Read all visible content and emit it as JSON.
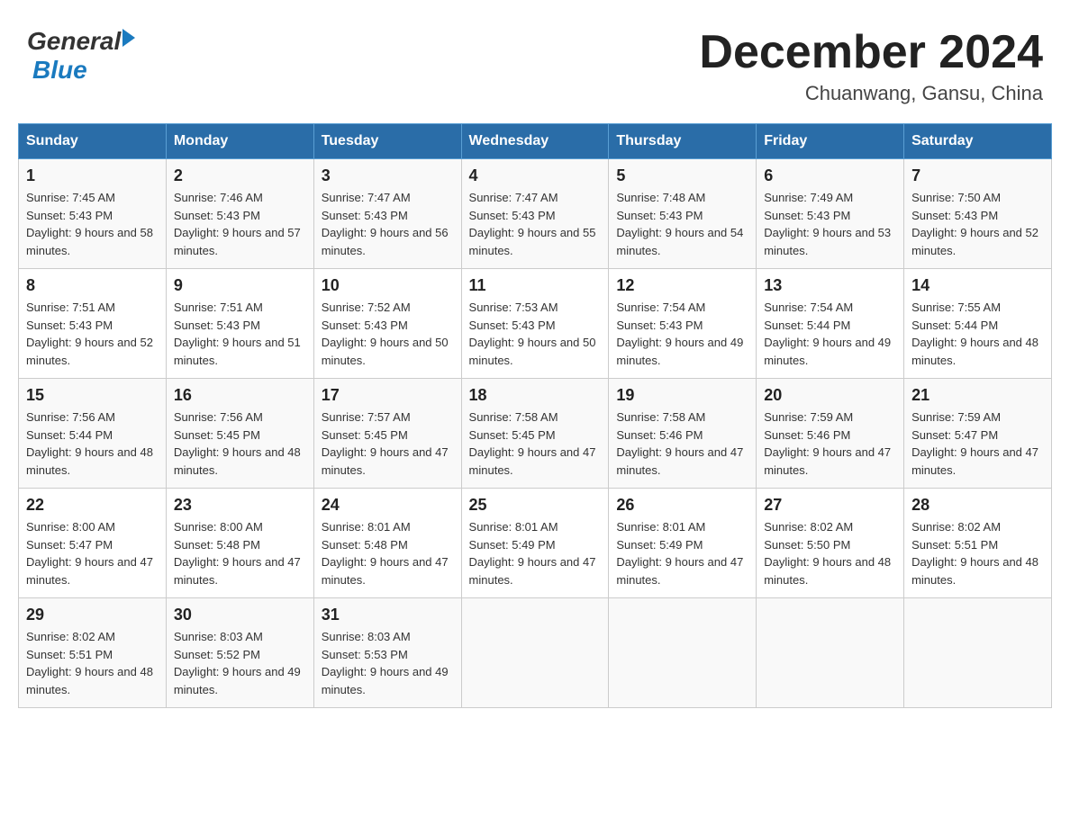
{
  "header": {
    "logo": {
      "general": "General",
      "blue": "Blue"
    },
    "title": "December 2024",
    "subtitle": "Chuanwang, Gansu, China"
  },
  "weekdays": [
    "Sunday",
    "Monday",
    "Tuesday",
    "Wednesday",
    "Thursday",
    "Friday",
    "Saturday"
  ],
  "weeks": [
    [
      {
        "day": "1",
        "sunrise": "7:45 AM",
        "sunset": "5:43 PM",
        "daylight": "9 hours and 58 minutes."
      },
      {
        "day": "2",
        "sunrise": "7:46 AM",
        "sunset": "5:43 PM",
        "daylight": "9 hours and 57 minutes."
      },
      {
        "day": "3",
        "sunrise": "7:47 AM",
        "sunset": "5:43 PM",
        "daylight": "9 hours and 56 minutes."
      },
      {
        "day": "4",
        "sunrise": "7:47 AM",
        "sunset": "5:43 PM",
        "daylight": "9 hours and 55 minutes."
      },
      {
        "day": "5",
        "sunrise": "7:48 AM",
        "sunset": "5:43 PM",
        "daylight": "9 hours and 54 minutes."
      },
      {
        "day": "6",
        "sunrise": "7:49 AM",
        "sunset": "5:43 PM",
        "daylight": "9 hours and 53 minutes."
      },
      {
        "day": "7",
        "sunrise": "7:50 AM",
        "sunset": "5:43 PM",
        "daylight": "9 hours and 52 minutes."
      }
    ],
    [
      {
        "day": "8",
        "sunrise": "7:51 AM",
        "sunset": "5:43 PM",
        "daylight": "9 hours and 52 minutes."
      },
      {
        "day": "9",
        "sunrise": "7:51 AM",
        "sunset": "5:43 PM",
        "daylight": "9 hours and 51 minutes."
      },
      {
        "day": "10",
        "sunrise": "7:52 AM",
        "sunset": "5:43 PM",
        "daylight": "9 hours and 50 minutes."
      },
      {
        "day": "11",
        "sunrise": "7:53 AM",
        "sunset": "5:43 PM",
        "daylight": "9 hours and 50 minutes."
      },
      {
        "day": "12",
        "sunrise": "7:54 AM",
        "sunset": "5:43 PM",
        "daylight": "9 hours and 49 minutes."
      },
      {
        "day": "13",
        "sunrise": "7:54 AM",
        "sunset": "5:44 PM",
        "daylight": "9 hours and 49 minutes."
      },
      {
        "day": "14",
        "sunrise": "7:55 AM",
        "sunset": "5:44 PM",
        "daylight": "9 hours and 48 minutes."
      }
    ],
    [
      {
        "day": "15",
        "sunrise": "7:56 AM",
        "sunset": "5:44 PM",
        "daylight": "9 hours and 48 minutes."
      },
      {
        "day": "16",
        "sunrise": "7:56 AM",
        "sunset": "5:45 PM",
        "daylight": "9 hours and 48 minutes."
      },
      {
        "day": "17",
        "sunrise": "7:57 AM",
        "sunset": "5:45 PM",
        "daylight": "9 hours and 47 minutes."
      },
      {
        "day": "18",
        "sunrise": "7:58 AM",
        "sunset": "5:45 PM",
        "daylight": "9 hours and 47 minutes."
      },
      {
        "day": "19",
        "sunrise": "7:58 AM",
        "sunset": "5:46 PM",
        "daylight": "9 hours and 47 minutes."
      },
      {
        "day": "20",
        "sunrise": "7:59 AM",
        "sunset": "5:46 PM",
        "daylight": "9 hours and 47 minutes."
      },
      {
        "day": "21",
        "sunrise": "7:59 AM",
        "sunset": "5:47 PM",
        "daylight": "9 hours and 47 minutes."
      }
    ],
    [
      {
        "day": "22",
        "sunrise": "8:00 AM",
        "sunset": "5:47 PM",
        "daylight": "9 hours and 47 minutes."
      },
      {
        "day": "23",
        "sunrise": "8:00 AM",
        "sunset": "5:48 PM",
        "daylight": "9 hours and 47 minutes."
      },
      {
        "day": "24",
        "sunrise": "8:01 AM",
        "sunset": "5:48 PM",
        "daylight": "9 hours and 47 minutes."
      },
      {
        "day": "25",
        "sunrise": "8:01 AM",
        "sunset": "5:49 PM",
        "daylight": "9 hours and 47 minutes."
      },
      {
        "day": "26",
        "sunrise": "8:01 AM",
        "sunset": "5:49 PM",
        "daylight": "9 hours and 47 minutes."
      },
      {
        "day": "27",
        "sunrise": "8:02 AM",
        "sunset": "5:50 PM",
        "daylight": "9 hours and 48 minutes."
      },
      {
        "day": "28",
        "sunrise": "8:02 AM",
        "sunset": "5:51 PM",
        "daylight": "9 hours and 48 minutes."
      }
    ],
    [
      {
        "day": "29",
        "sunrise": "8:02 AM",
        "sunset": "5:51 PM",
        "daylight": "9 hours and 48 minutes."
      },
      {
        "day": "30",
        "sunrise": "8:03 AM",
        "sunset": "5:52 PM",
        "daylight": "9 hours and 49 minutes."
      },
      {
        "day": "31",
        "sunrise": "8:03 AM",
        "sunset": "5:53 PM",
        "daylight": "9 hours and 49 minutes."
      },
      null,
      null,
      null,
      null
    ]
  ]
}
